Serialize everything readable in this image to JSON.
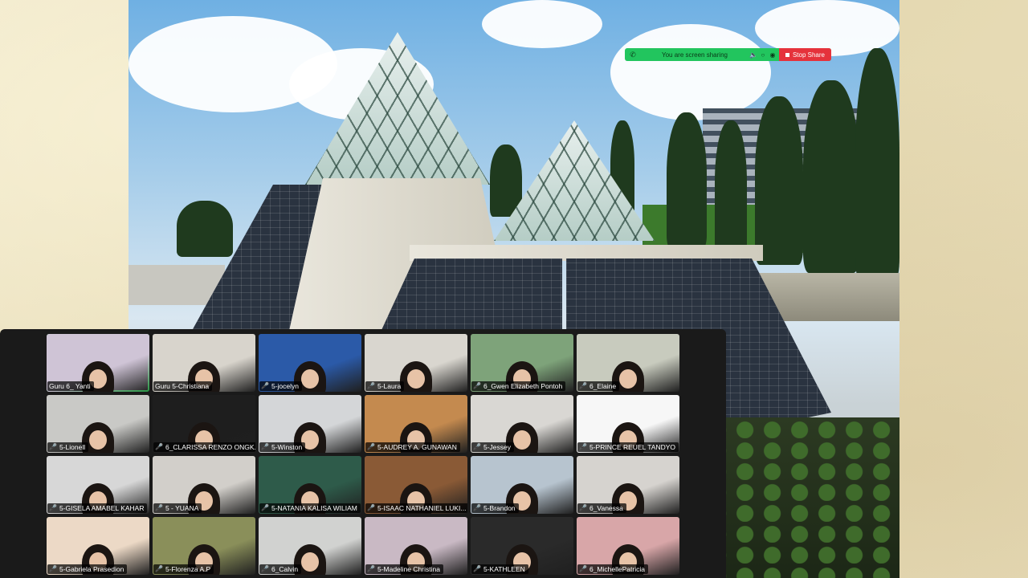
{
  "share_bar": {
    "message": "You are screen sharing",
    "stop_label": "Stop Share",
    "accent": "#22c55e",
    "stop_color": "#e5323b"
  },
  "gallery": {
    "participants": [
      {
        "name": "Guru 6_ Yanti",
        "muted": false,
        "active": true,
        "bg": "#cfc4d6"
      },
      {
        "name": "Guru 5-Christiana",
        "muted": false,
        "bg": "#d8d4cc"
      },
      {
        "name": "5-jocelyn",
        "muted": true,
        "bg": "#2b5aa8"
      },
      {
        "name": "5-Laura",
        "muted": true,
        "bg": "#d9d6cf"
      },
      {
        "name": "6_Gwen Elizabeth Pontoh",
        "muted": true,
        "bg": "#7ea37a"
      },
      {
        "name": "6_Elaine",
        "muted": true,
        "bg": "#c8cbbe"
      },
      {
        "name": "5-Lionell",
        "muted": true,
        "bg": "#c9c9c6"
      },
      {
        "name": "6_CLARISSA RENZO ONGK...",
        "muted": true,
        "bg": "#1e1e1e"
      },
      {
        "name": "5-Winston",
        "muted": true,
        "bg": "#d4d6d8"
      },
      {
        "name": "5-AUDREY A. GUNAWAN",
        "muted": true,
        "bg": "#c48a4f"
      },
      {
        "name": "5-Jessey",
        "muted": true,
        "bg": "#d9d7d3"
      },
      {
        "name": "5-PRINCE REUEL TANDYO",
        "muted": true,
        "bg": "#f7f7f7"
      },
      {
        "name": "5-GISELA AMABEL KAHAR",
        "muted": true,
        "bg": "#d7d7d7"
      },
      {
        "name": "5 - YUANA",
        "muted": true,
        "bg": "#d2cfca"
      },
      {
        "name": "5-NATANIA KALISA WILIAM",
        "muted": true,
        "bg": "#2e5b4a"
      },
      {
        "name": "5-ISAAC NATHANIEL LUKI...",
        "muted": true,
        "bg": "#8a5a36"
      },
      {
        "name": "5-Brandon",
        "muted": true,
        "bg": "#b7c4cf"
      },
      {
        "name": "6_Vanessa",
        "muted": true,
        "bg": "#d6d3cf"
      },
      {
        "name": "5-Gabriela Prasedion",
        "muted": true,
        "bg": "#ecd9c6"
      },
      {
        "name": "5-Florenza A.P",
        "muted": true,
        "bg": "#8a8f5a"
      },
      {
        "name": "6_Calvin",
        "muted": true,
        "bg": "#d1d2d0"
      },
      {
        "name": "5-Madeline Christina",
        "muted": true,
        "bg": "#c9b9c4"
      },
      {
        "name": "5-KATHLEEN",
        "muted": true,
        "bg": "#2a2a2a"
      },
      {
        "name": "6_MichellePatricia",
        "muted": true,
        "bg": "#d8a6a8"
      }
    ]
  }
}
